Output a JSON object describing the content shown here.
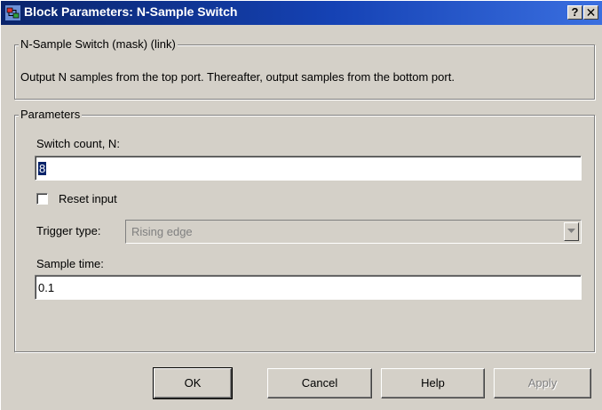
{
  "window": {
    "title": "Block Parameters: N-Sample Switch",
    "help_glyph": "?",
    "close_glyph": "✕",
    "icon": "simulink-block-icon"
  },
  "description": {
    "group_title": "N-Sample Switch (mask) (link)",
    "text": "Output N samples from the top port.  Thereafter, output samples from the bottom port."
  },
  "parameters": {
    "group_title": "Parameters",
    "switch_count": {
      "label": "Switch count, N:",
      "value": "8"
    },
    "reset_input": {
      "label": "Reset input",
      "checked": false
    },
    "trigger_type": {
      "label": "Trigger type:",
      "value": "Rising edge",
      "enabled": false
    },
    "sample_time": {
      "label": "Sample time:",
      "value": "0.1"
    }
  },
  "buttons": {
    "ok": "OK",
    "cancel": "Cancel",
    "help": "Help",
    "apply": "Apply"
  },
  "colors": {
    "titlebar": "#0a246a",
    "face": "#d4d0c8",
    "selection": "#0a246a",
    "disabled_text": "#808080"
  }
}
